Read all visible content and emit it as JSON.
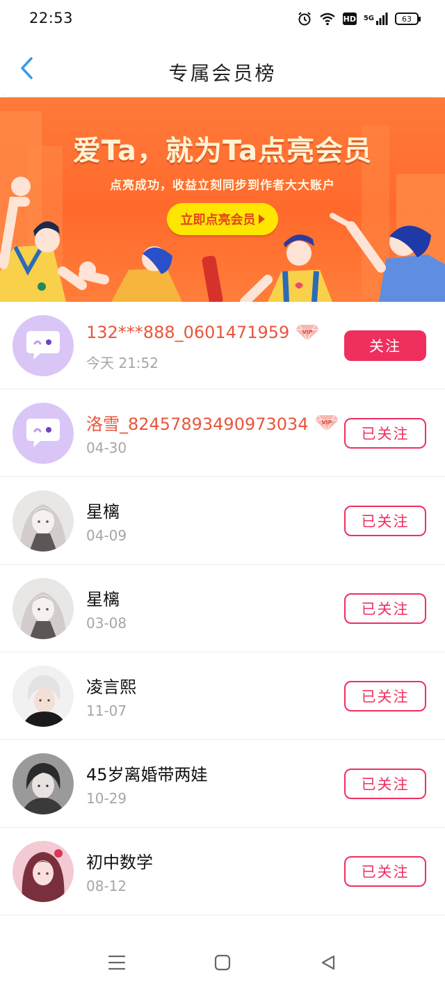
{
  "status_bar": {
    "time": "22:53",
    "network": "5G",
    "battery": "63"
  },
  "header": {
    "title": "专属会员榜"
  },
  "banner": {
    "title": "爱Ta，就为Ta点亮会员",
    "subtitle": "点亮成功，收益立刻同步到作者大大账户",
    "cta": "立即点亮会员"
  },
  "vip_badge_text": "VIP",
  "members": [
    {
      "name": "132***888_0601471959",
      "date": "今天 21:52",
      "vip": true,
      "avatar": "default-chat-icon",
      "button": "关注",
      "followed": false
    },
    {
      "name": "洛雪_824578934909​73034",
      "date": "04-30",
      "vip": true,
      "avatar": "default-chat-icon",
      "button": "已关注",
      "followed": true
    },
    {
      "name": "星樆",
      "date": "04-09",
      "vip": false,
      "avatar": "anime-girl-avatar",
      "button": "已关注",
      "followed": true
    },
    {
      "name": "星樆",
      "date": "03-08",
      "vip": false,
      "avatar": "anime-girl-avatar",
      "button": "已关注",
      "followed": true
    },
    {
      "name": "凌言熙",
      "date": "11-07",
      "vip": false,
      "avatar": "white-hair-avatar",
      "button": "已关注",
      "followed": true
    },
    {
      "name": "45岁离婚带两娃",
      "date": "10-29",
      "vip": false,
      "avatar": "dark-hair-avatar",
      "button": "已关注",
      "followed": true
    },
    {
      "name": "初中数学",
      "date": "08-12",
      "vip": false,
      "avatar": "pink-girl-avatar",
      "button": "已关注",
      "followed": true
    }
  ],
  "colors": {
    "accent": "#ef2f5e",
    "vip_name": "#e8553b",
    "back_arrow": "#3a9ae8",
    "banner_bg": "#ff6a2c",
    "cta_bg": "#ffe600"
  }
}
